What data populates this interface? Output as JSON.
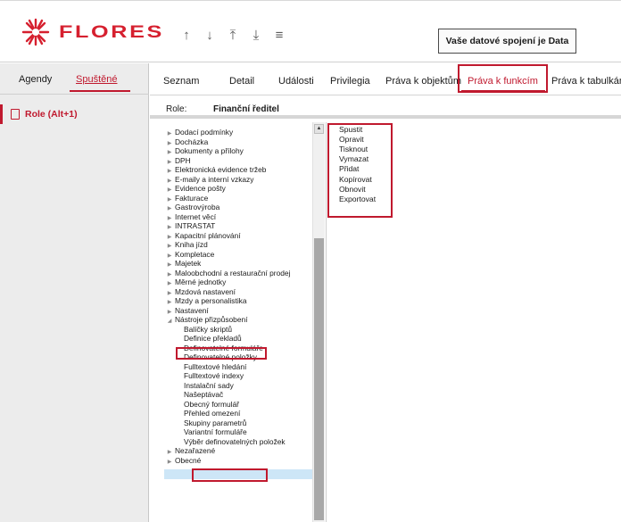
{
  "header": {
    "logo_text": "FLORES",
    "nav_arrows": [
      "↑",
      "↓",
      "⤒",
      "⤓",
      "≡"
    ],
    "status": "Vaše datové spojení je Data"
  },
  "left": {
    "tabs": [
      "Agendy",
      "Spuštěné"
    ],
    "items": [
      {
        "label": "Role (Alt+1)"
      }
    ]
  },
  "tabs": {
    "seznam": "Seznam",
    "detail": "Detail",
    "udalosti": "Události",
    "privilegia": "Privilegia",
    "objekty": "Práva k objektům",
    "funkce": "Práva k funkcím",
    "tabulky": "Práva k tabulkám"
  },
  "role_row": {
    "label": "Role:",
    "value": "Finanční ředitel"
  },
  "tree": {
    "nodes": [
      "Dodací podmínky",
      "Docházka",
      "Dokumenty a přílohy",
      "DPH",
      "Elektronická evidence tržeb",
      "E-maily a interní vzkazy",
      "Evidence pošty",
      "Fakturace",
      "Gastrovýroba",
      "Internet věcí",
      "INTRASTAT",
      "Kapacitní plánování",
      "Kniha jízd",
      "Kompletace",
      "Majetek",
      "Maloobchodní a restaurační prodej",
      "Měrné jednotky",
      "Mzdová nastavení",
      "Mzdy a personalistika",
      "Nastavení",
      "Nástroje přizpůsobení"
    ],
    "children": [
      "Balíčky skriptů",
      "Definice překladů",
      "Definovatelné formuláře",
      "Definovatelné položky",
      "Fulltextové hledání",
      "Fulltextové indexy",
      "Instalační sady",
      "Našeptávač",
      "Obecný formulář",
      "Přehled omezení",
      "Skupiny parametrů",
      "Variantní formuláře",
      "Výběr definovatelných položek"
    ],
    "after": [
      "Nezařazené",
      "Obecné"
    ],
    "selected": "Skupiny parametrů"
  },
  "functions": [
    "Spustit",
    "Opravit",
    "Tisknout",
    "Vymazat",
    "Přidat",
    "Kopírovat",
    "Obnovit",
    "Exportovat"
  ],
  "colors": {
    "accent": "#c0192e",
    "selection": "#cde6f7"
  }
}
